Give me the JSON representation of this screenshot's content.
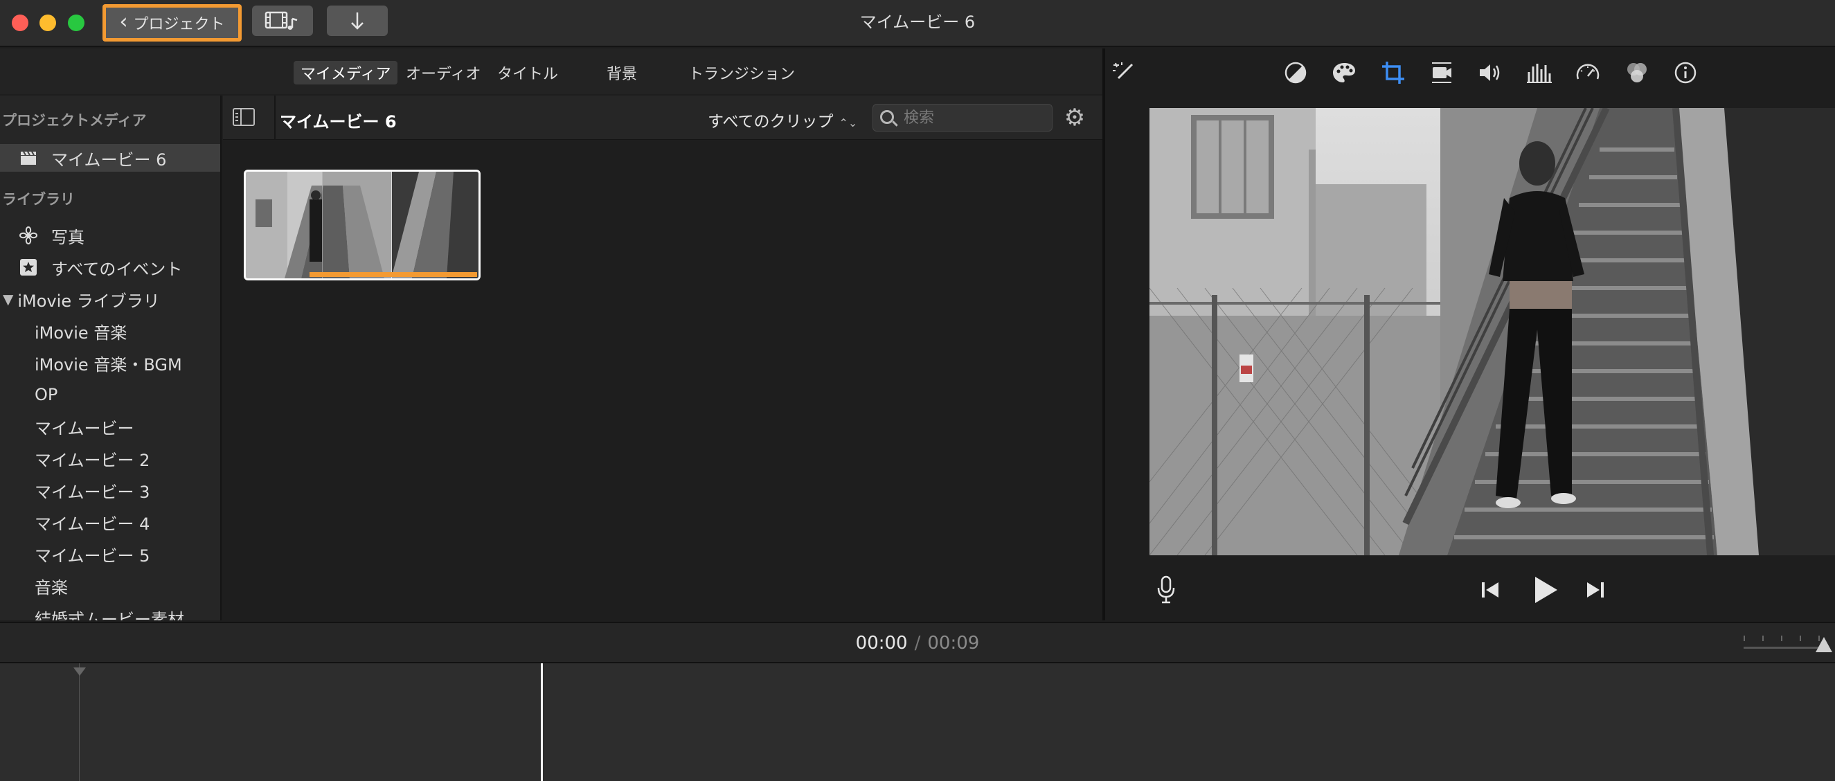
{
  "window": {
    "title": "マイムービー 6"
  },
  "toolbar": {
    "back_label": "プロジェクト",
    "media_icon": "film-music-icon",
    "import_icon": "import-arrow-icon"
  },
  "tabs": [
    {
      "label": "マイメディア",
      "active": true
    },
    {
      "label": "オーディオ",
      "active": false
    },
    {
      "label": "タイトル",
      "active": false
    },
    {
      "label": "背景",
      "active": false
    },
    {
      "label": "トランジション",
      "active": false
    }
  ],
  "sidebar": {
    "project_media_header": "プロジェクトメディア",
    "project_item": "マイムービー 6",
    "libraries_header": "ライブラリ",
    "photos": "写真",
    "all_events": "すべてのイベント",
    "library_name": "iMovie ライブラリ",
    "events": [
      "iMovie 音楽",
      "iMovie 音楽・BGM",
      "OP",
      "マイムービー",
      "マイムービー 2",
      "マイムービー 3",
      "マイムービー 4",
      "マイムービー 5",
      "音楽",
      "結婚式ムービー素材"
    ]
  },
  "browser": {
    "title": "マイムービー 6",
    "clip_filter": "すべてのクリップ",
    "search_placeholder": "検索"
  },
  "viewer": {
    "tools": [
      "magic-wand-icon",
      "color-balance-icon",
      "color-palette-icon",
      "crop-icon",
      "stabilization-icon",
      "volume-icon",
      "equalizer-icon",
      "speed-icon",
      "filter-icon",
      "info-icon"
    ],
    "active_tool": "crop-icon"
  },
  "timeline": {
    "current": "00:00",
    "separator": "/",
    "total": "00:09"
  },
  "colors": {
    "accent_orange": "#f39a32",
    "active_blue": "#3d8ef4"
  }
}
